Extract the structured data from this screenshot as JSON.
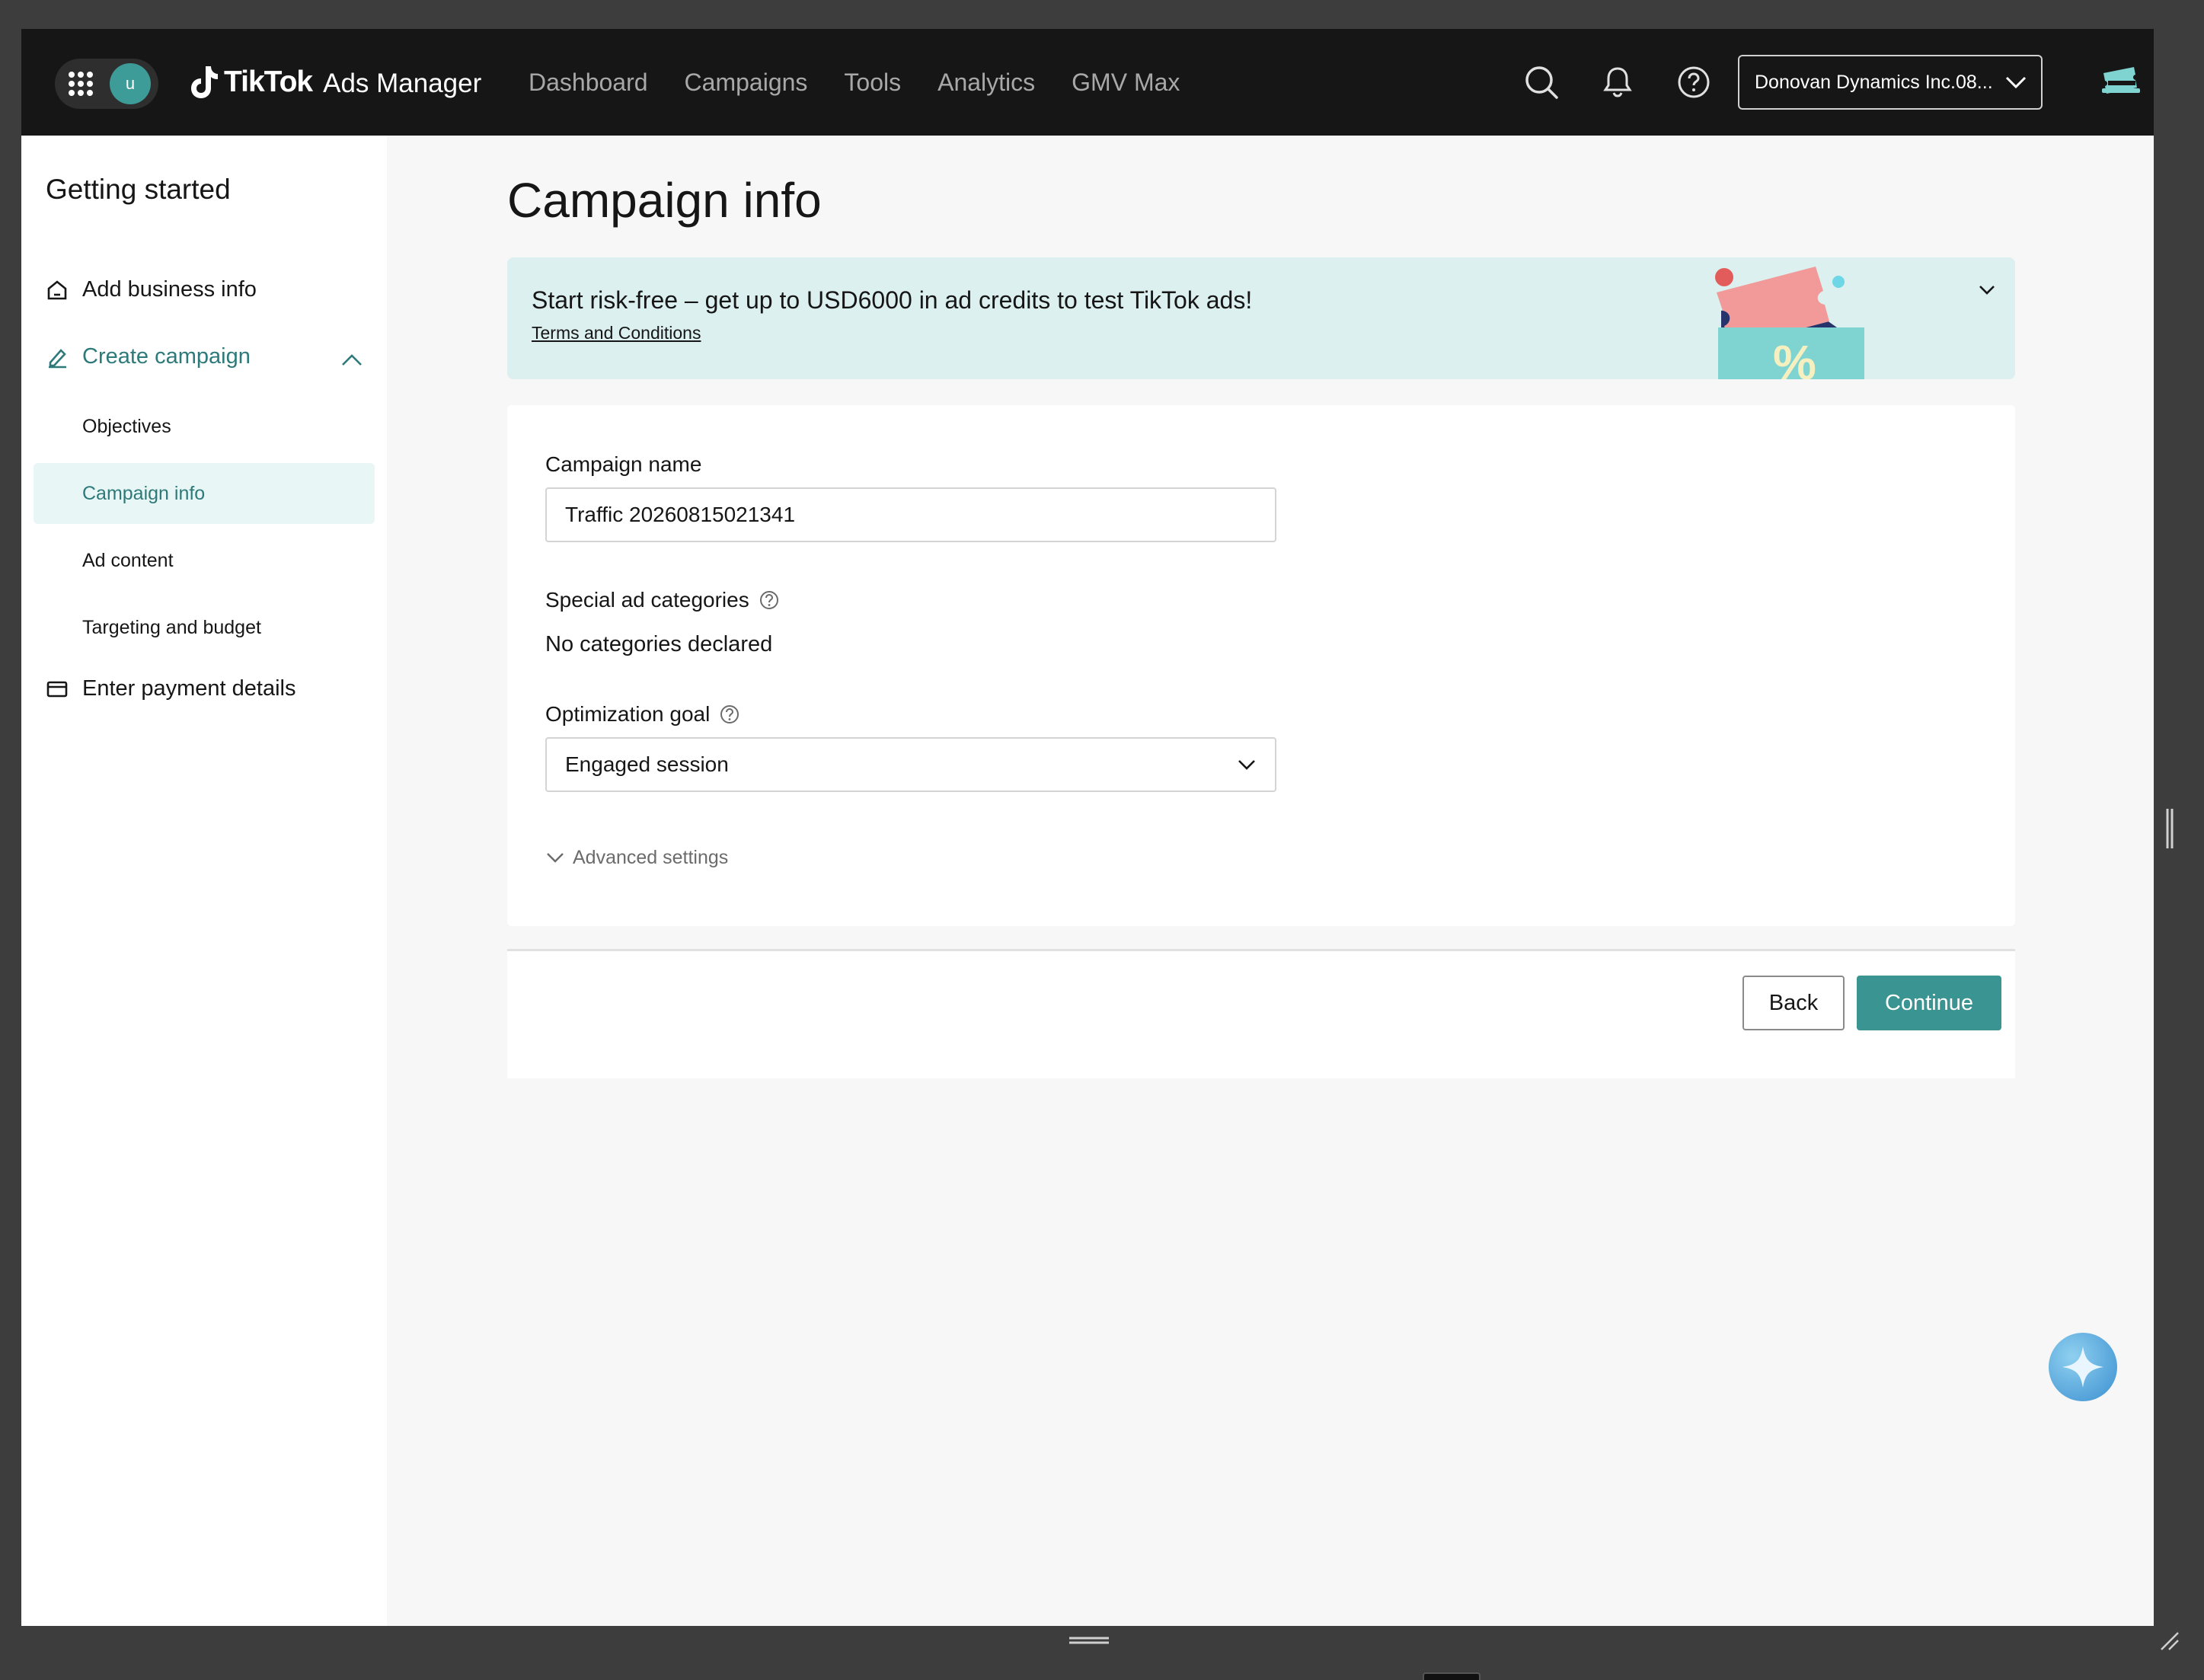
{
  "app": {
    "avatar_initial": "u",
    "logo_brand": "TikTok",
    "logo_product": "Ads Manager"
  },
  "nav": {
    "items": [
      {
        "label": "Dashboard"
      },
      {
        "label": "Campaigns"
      },
      {
        "label": "Tools"
      },
      {
        "label": "Analytics"
      },
      {
        "label": "GMV Max"
      }
    ]
  },
  "header": {
    "account_name": "Donovan Dynamics Inc.08...",
    "icons": [
      "search-icon",
      "bell-icon",
      "help-icon",
      "gift-icon"
    ]
  },
  "sidebar": {
    "title": "Getting started",
    "add_business": "Add business info",
    "create_campaign": "Create campaign",
    "sub_items": [
      {
        "label": "Objectives"
      },
      {
        "label": "Campaign info"
      },
      {
        "label": "Ad content"
      },
      {
        "label": "Targeting and budget"
      }
    ],
    "selected_sub": "Campaign info",
    "payment": "Enter payment details"
  },
  "main": {
    "title": "Campaign info",
    "banner": {
      "text": "Start risk-free – get up to USD6000 in ad credits to test TikTok ads!",
      "link": "Terms and Conditions"
    },
    "campaign_name_label": "Campaign name",
    "campaign_name_value": "Traffic 20260815021341",
    "special_categories_label": "Special ad categories",
    "special_categories_value": "No categories declared",
    "optimization_goal_label": "Optimization goal",
    "optimization_goal_value": "Engaged session",
    "advanced_settings": "Advanced settings"
  },
  "footer": {
    "back": "Back",
    "continue": "Continue"
  },
  "colors": {
    "accent": "#3a9492",
    "accent_text": "#2e7a7a",
    "topbar": "#161616",
    "banner_bg": "#dcf0ef",
    "selected_bg": "#e8f6f5"
  }
}
